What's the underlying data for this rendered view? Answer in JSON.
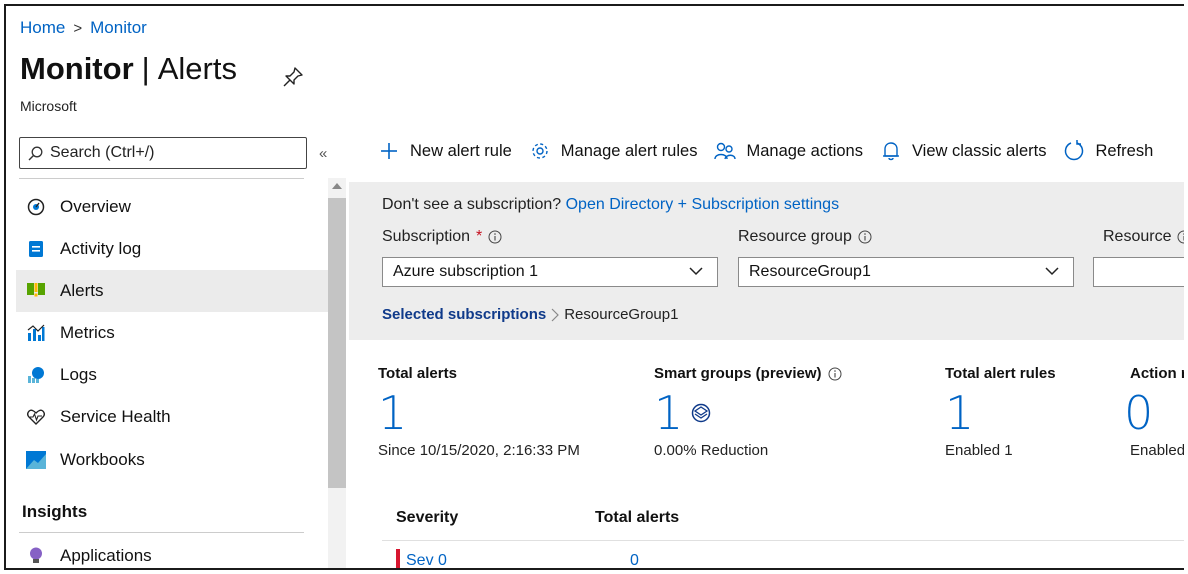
{
  "breadcrumb": {
    "home": "Home",
    "separator": ">",
    "current": "Monitor"
  },
  "header": {
    "title_bold": "Monitor",
    "title_sep": "|",
    "title_rest": "Alerts",
    "subtitle": "Microsoft"
  },
  "sidebar": {
    "search_placeholder": "Search (Ctrl+/)",
    "collapse": "«",
    "items": [
      {
        "label": "Overview",
        "icon": "overview-icon"
      },
      {
        "label": "Activity log",
        "icon": "activity-log-icon"
      },
      {
        "label": "Alerts",
        "icon": "alerts-icon",
        "active": true
      },
      {
        "label": "Metrics",
        "icon": "metrics-icon"
      },
      {
        "label": "Logs",
        "icon": "logs-icon"
      },
      {
        "label": "Service Health",
        "icon": "heart-icon"
      },
      {
        "label": "Workbooks",
        "icon": "workbooks-icon"
      }
    ],
    "section_insights": "Insights",
    "insights_items": [
      {
        "label": "Applications",
        "icon": "lightbulb-icon"
      }
    ]
  },
  "toolbar": {
    "new_alert_rule": "New alert rule",
    "manage_alert_rules": "Manage alert rules",
    "manage_actions": "Manage actions",
    "view_classic_alerts": "View classic alerts",
    "refresh": "Refresh"
  },
  "filters": {
    "notice_text": "Don't see a subscription?",
    "notice_link": "Open Directory + Subscription settings",
    "subscription_label": "Subscription",
    "required_marker": "*",
    "subscription_value": "Azure subscription 1",
    "resource_group_label": "Resource group",
    "resource_group_value": "ResourceGroup1",
    "resource_label": "Resource",
    "selected_subscriptions": "Selected subscriptions",
    "selected_resource_group": "ResourceGroup1"
  },
  "summary": {
    "total_alerts": {
      "label": "Total alerts",
      "value": "1",
      "sub": "Since 10/15/2020, 2:16:33 PM"
    },
    "smart_groups": {
      "label": "Smart groups (preview)",
      "value": "1",
      "sub": "0.00% Reduction"
    },
    "total_alert_rules": {
      "label": "Total alert rules",
      "value": "1",
      "sub": "Enabled 1"
    },
    "action_rules": {
      "label": "Action ru",
      "value": "0",
      "sub": "Enabled ("
    }
  },
  "table": {
    "headers": [
      "Severity",
      "Total alerts"
    ],
    "rows": [
      {
        "severity": "Sev 0",
        "total": "0"
      }
    ]
  },
  "colors": {
    "link": "#0063c4",
    "sev0": "#d7162f",
    "panel": "#ededed",
    "active_nav": "#ebebeb"
  }
}
